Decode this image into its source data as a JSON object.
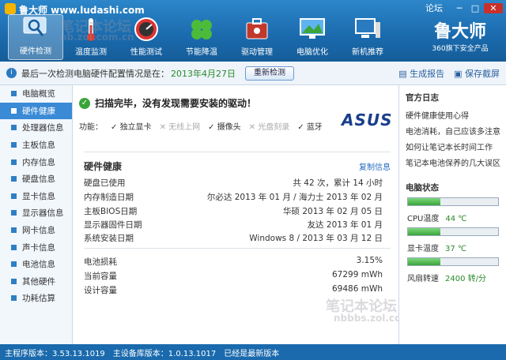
{
  "window": {
    "title": "鲁大师 www.ludashi.com",
    "forum": "论坛",
    "min": "─",
    "max": "□",
    "close": "✕"
  },
  "toolbar": [
    {
      "label": "硬件检测",
      "icon": "monitor-magnifier-icon",
      "active": true
    },
    {
      "label": "温度监测",
      "icon": "thermometer-icon"
    },
    {
      "label": "性能测试",
      "icon": "speedometer-icon"
    },
    {
      "label": "节能降温",
      "icon": "clover-icon"
    },
    {
      "label": "驱动管理",
      "icon": "toolbox-icon"
    },
    {
      "label": "电脑优化",
      "icon": "screen-optimize-icon"
    },
    {
      "label": "新机推荐",
      "icon": "computer-icon"
    }
  ],
  "brand": {
    "name": "鲁大师",
    "tagline": "360旗下安全产品"
  },
  "infobar": {
    "text": "最后一次检测电脑硬件配置情况是在：",
    "date": "2013年4月27日",
    "recheck": "重新检测",
    "report": "生成报告",
    "screenshot": "保存截屏"
  },
  "sidebar": [
    "电脑概览",
    "硬件健康",
    "处理器信息",
    "主板信息",
    "内存信息",
    "硬盘信息",
    "显卡信息",
    "显示器信息",
    "网卡信息",
    "声卡信息",
    "电池信息",
    "其他硬件",
    "功耗估算"
  ],
  "main": {
    "banner": "扫描完毕，没有发现需要安装的驱动！",
    "features_label": "功能：",
    "features": [
      {
        "label": "独立显卡",
        "on": true
      },
      {
        "label": "无线上网",
        "on": false
      },
      {
        "label": "摄像头",
        "on": true
      },
      {
        "label": "光盘刻录",
        "on": false
      },
      {
        "label": "蓝牙",
        "on": true
      }
    ],
    "vendor": "ASUS",
    "health_title": "硬件健康",
    "copy": "复制信息",
    "rows1": [
      {
        "k": "硬盘已使用",
        "v": "共 42 次，累计 14 小时"
      },
      {
        "k": "内存制造日期",
        "v": "尔必达 2013 年 01 月 / 海力士 2013 年 02 月"
      },
      {
        "k": "主板BIOS日期",
        "v": "华硕 2013 年 02 月 05 日"
      },
      {
        "k": "显示器固件日期",
        "v": "友达 2013 年 01 月"
      },
      {
        "k": "系统安装日期",
        "v": "Windows 8 / 2013 年 03 月 12 日"
      }
    ],
    "rows2": [
      {
        "k": "电池损耗",
        "v": "3.15%"
      },
      {
        "k": "当前容量",
        "v": "67299 mWh"
      },
      {
        "k": "设计容量",
        "v": "69486 mWh"
      }
    ]
  },
  "right": {
    "log_title": "官方日志",
    "links": [
      "硬件健康使用心得",
      "电池消耗，自己应该多注意",
      "如何让笔记本长时间工作",
      "笔记本电池保养的几大误区"
    ],
    "status_title": "电脑状态",
    "cpu_label": "CPU温度",
    "cpu_value": "44 ℃",
    "cpu_level": 0.36,
    "gpu_label": "显卡温度",
    "gpu_value": "37 ℃",
    "gpu_level": 0.36,
    "fan_label": "风扇转速",
    "fan_value": "2400 转/分",
    "fan_level": 0.36,
    "top_level": 0.36
  },
  "statusbar": {
    "main": "主程序版本：3.53.13.1019",
    "hw": "主设备库版本：1.0.13.1017",
    "latest": "已经是最新版本"
  },
  "watermarks": [
    "笔记本论坛",
    "nb.zol.com.cn",
    "笔记本论坛",
    "nbbbs.zol.com.cn"
  ]
}
